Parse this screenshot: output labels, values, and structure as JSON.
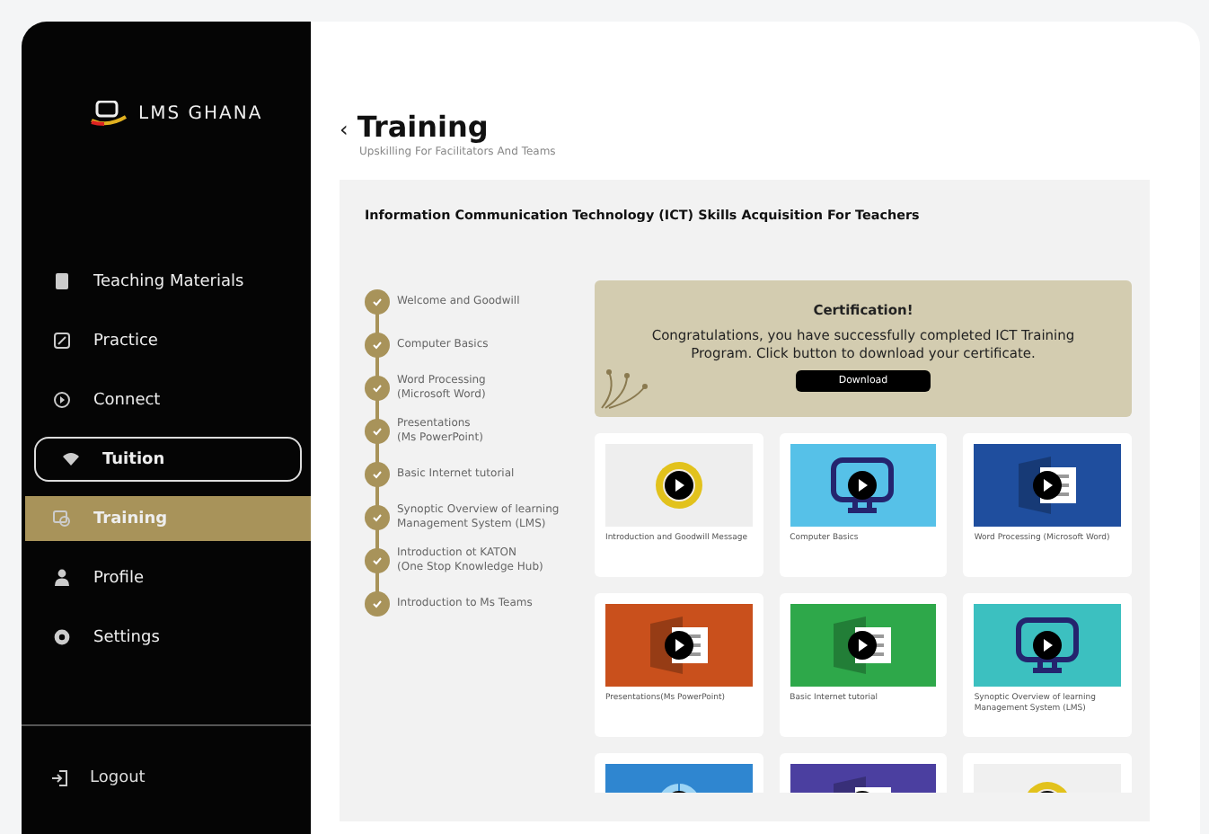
{
  "brand": {
    "name": "LMS GHANA"
  },
  "sidebar": {
    "items": [
      {
        "label": "Teaching Materials",
        "selected": false,
        "focused": false
      },
      {
        "label": "Practice",
        "selected": false,
        "focused": false
      },
      {
        "label": "Connect",
        "selected": false,
        "focused": false
      },
      {
        "label": "Tuition",
        "selected": false,
        "focused": true
      },
      {
        "label": "Training",
        "selected": true,
        "focused": false
      },
      {
        "label": "Profile",
        "selected": false,
        "focused": false
      },
      {
        "label": "Settings",
        "selected": false,
        "focused": false
      }
    ],
    "logout": "Logout"
  },
  "header": {
    "back": "‹",
    "title": "Training",
    "subtitle": "Upskilling For Facilitators And Teams"
  },
  "course": {
    "title": "Information Communication Technology (ICT) Skills Acquisition For Teachers",
    "steps": [
      {
        "label": "Welcome and Goodwill",
        "completed": true
      },
      {
        "label": "Computer Basics",
        "completed": true
      },
      {
        "label": "Word Processing\n(Microsoft Word)",
        "completed": true
      },
      {
        "label": "Presentations\n(Ms PowerPoint)",
        "completed": true
      },
      {
        "label": "Basic Internet tutorial",
        "completed": true
      },
      {
        "label": "Synoptic Overview of learning\nManagement System (LMS)",
        "completed": true
      },
      {
        "label": "Introduction ot KATON\n(One Stop Knowledge Hub)",
        "completed": true
      },
      {
        "label": "Introduction to Ms Teams",
        "completed": true
      }
    ],
    "certificate": {
      "title": "Certification!",
      "message": "Congratulations, you have successfully completed ICT Training Program. Click button to download your certificate.",
      "button": "Download"
    },
    "videos": [
      {
        "caption": "Introduction and Goodwill Message",
        "color": "#eeeeee",
        "kind": "seal"
      },
      {
        "caption": "Computer Basics",
        "color": "#56c1e8",
        "kind": "monitor"
      },
      {
        "caption": "Word Processing (Microsoft Word)",
        "color": "#1f4e9e",
        "kind": "document"
      },
      {
        "caption": "Presentations(Ms PowerPoint)",
        "color": "#c9501c",
        "kind": "document"
      },
      {
        "caption": "Basic Internet tutorial",
        "color": "#2ea84a",
        "kind": "document"
      },
      {
        "caption": "Synoptic Overview of learning Management System (LMS)",
        "color": "#3cc0c0",
        "kind": "monitor"
      },
      {
        "color": "#2f86d0",
        "kind": "globe"
      },
      {
        "color": "#4b3fa0",
        "kind": "document"
      },
      {
        "color": "#f0f0f0",
        "kind": "seal"
      }
    ]
  }
}
